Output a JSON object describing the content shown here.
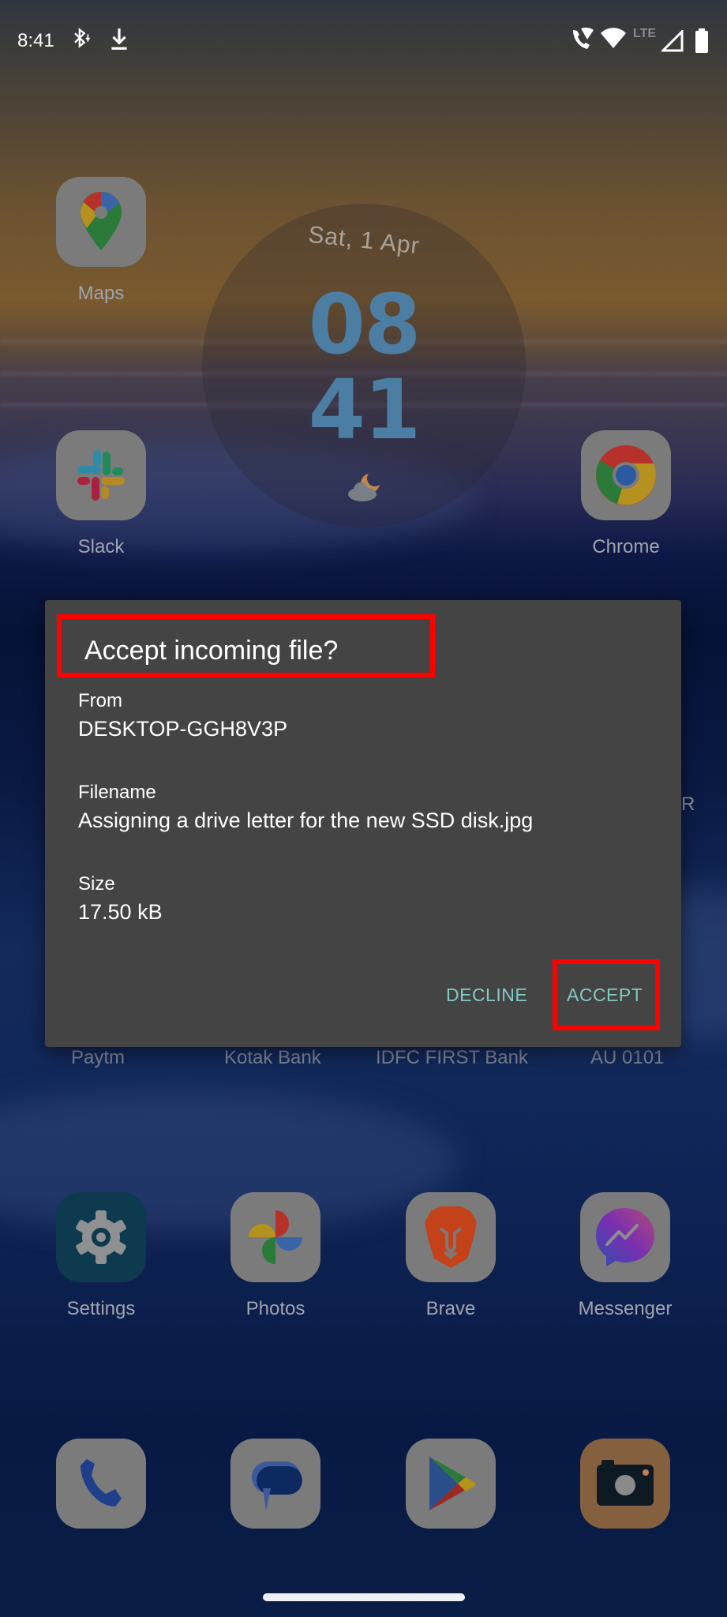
{
  "status_bar": {
    "time": "8:41",
    "left_icons": [
      "bluetooth-data-icon",
      "download-icon"
    ],
    "right_icons": [
      "wifi-calling-icon",
      "wifi-icon",
      "lte-icon",
      "signal-icon",
      "battery-icon"
    ],
    "network_label": "LTE"
  },
  "clock_widget": {
    "date": "Sat, 1 Apr",
    "hour": "08",
    "minute": "41",
    "weather_icon": "partly-cloudy-night-icon"
  },
  "home_apps": [
    {
      "label": "Maps",
      "icon": "google-maps-icon"
    },
    {
      "label": "Slack",
      "icon": "slack-icon"
    },
    {
      "label": "Chrome",
      "icon": "chrome-icon"
    }
  ],
  "bank_row": [
    "Paytm",
    "Kotak Bank",
    "IDFC FIRST Bank",
    "AU 0101"
  ],
  "partial_label": "R",
  "app_row": [
    {
      "label": "Settings",
      "icon": "settings-icon"
    },
    {
      "label": "Photos",
      "icon": "google-photos-icon"
    },
    {
      "label": "Brave",
      "icon": "brave-icon"
    },
    {
      "label": "Messenger",
      "icon": "messenger-icon"
    }
  ],
  "dock": [
    {
      "icon": "phone-icon"
    },
    {
      "icon": "messages-icon"
    },
    {
      "icon": "play-store-icon"
    },
    {
      "icon": "camera-icon"
    }
  ],
  "dialog": {
    "title": "Accept incoming file?",
    "from_label": "From",
    "from_value": "DESKTOP-GGH8V3P",
    "filename_label": "Filename",
    "filename_value": "Assigning a drive letter for the new SSD disk.jpg",
    "size_label": "Size",
    "size_value": "17.50 kB",
    "decline_label": "DECLINE",
    "accept_label": "ACCEPT",
    "button_color": "#80cbc4",
    "highlight_color": "#ff0000"
  }
}
